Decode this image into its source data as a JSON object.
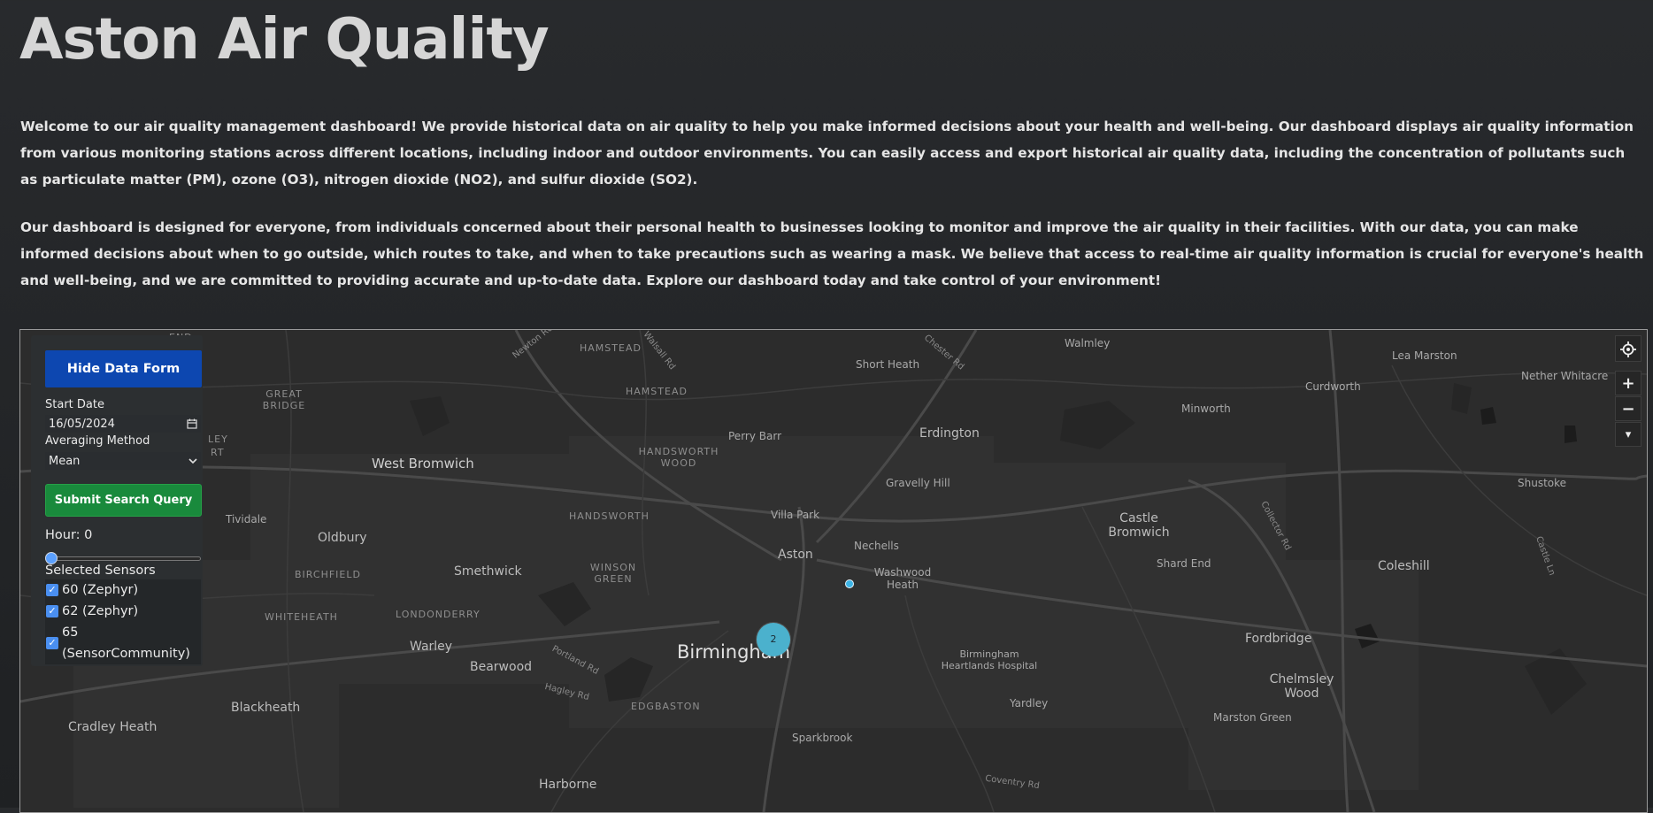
{
  "page": {
    "title": "Aston Air Quality",
    "intro_paragraph_1": "Welcome to our air quality management dashboard! We provide historical data on air quality to help you make informed decisions about your health and well-being. Our dashboard displays air quality information from various monitoring stations across different locations, including indoor and outdoor environments. You can easily access and export historical air quality data, including the concentration of pollutants such as particulate matter (PM), ozone (O3), nitrogen dioxide (NO2), and sulfur dioxide (SO2).",
    "intro_paragraph_2": "Our dashboard is designed for everyone, from individuals concerned about their personal health to businesses looking to monitor and improve the air quality in their facilities. With our data, you can make informed decisions about when to go outside, which routes to take, and when to take precautions such as wearing a mask. We believe that access to real-time air quality information is crucial for everyone's health and well-being, and we are committed to providing accurate and up-to-date data. Explore our dashboard today and take control of your environment!"
  },
  "form": {
    "hide_button": "Hide Data Form",
    "start_date_label": "Start Date",
    "start_date_value": "16/05/2024",
    "averaging_label": "Averaging Method",
    "averaging_value": "Mean",
    "submit_button": "Submit Search Query",
    "hour_label": "Hour: 0",
    "hour_value": 0,
    "sensors_label": "Selected Sensors",
    "sensors": [
      {
        "label": "60 (Zephyr)",
        "checked": true
      },
      {
        "label": "62 (Zephyr)",
        "checked": true
      },
      {
        "label": "65 (SensorCommunity)",
        "checked": true
      }
    ]
  },
  "map": {
    "cluster_count": "2",
    "controls": {
      "locate_icon": "locate-icon",
      "zoom_in": "+",
      "zoom_out": "−",
      "compass": "▾"
    },
    "places": {
      "end": "END",
      "hamstead1": "HAMSTEAD",
      "hamstead2": "HAMSTEAD",
      "short_heath": "Short Heath",
      "walmley": "Walmley",
      "lea_marston": "Lea Marston",
      "nether_whitacre": "Nether Whitacre",
      "curdworth": "Curdworth",
      "minworth": "Minworth",
      "great_bridge": "GREAT BRIDGE",
      "ley": "LEY",
      "rt": "RT",
      "west_bromwich": "West Bromwich",
      "perry_barr": "Perry Barr",
      "erdington": "Erdington",
      "handsworth_wood": "HANDSWORTH WOOD",
      "gravelly_hill": "Gravelly Hill",
      "shustoke": "Shustoke",
      "tividale": "Tividale",
      "handsworth": "HANDSWORTH",
      "villa_park": "Villa Park",
      "castle_bromwich": "Castle Bromwich",
      "oldbury": "Oldbury",
      "nechells": "Nechells",
      "aston": "Aston",
      "birchfield": "BIRCHFIELD",
      "smethwick": "Smethwick",
      "winson_green": "WINSON GREEN",
      "washwood_heath": "Washwood Heath",
      "shard_end": "Shard End",
      "coleshill": "Coleshill",
      "whiteheath": "WHITEHEATH",
      "londonderry": "LONDONDERRY",
      "fordbridge": "Fordbridge",
      "warley": "Warley",
      "birmingham": "Birmingham",
      "bearwood": "Bearwood",
      "birmingham_heartlands": "Birmingham Heartlands Hospital",
      "chelmsley_wood": "Chelmsley Wood",
      "blackheath": "Blackheath",
      "edgbaston": "EDGBASTON",
      "yardley": "Yardley",
      "cradley_heath": "Cradley Heath",
      "marston_green": "Marston Green",
      "sparkbrook": "Sparkbrook",
      "harborne": "Harborne"
    },
    "roads": {
      "newton_rd": "Newton Rd",
      "walsall_rd": "Walsall Rd",
      "chester_rd": "Chester Rd",
      "collector_rd": "Collector Rd",
      "castle_ln": "Castle Ln",
      "portland_rd": "Portland Rd",
      "hagley_rd": "Hagley Rd",
      "coventry_rd": "Coventry Rd"
    }
  }
}
